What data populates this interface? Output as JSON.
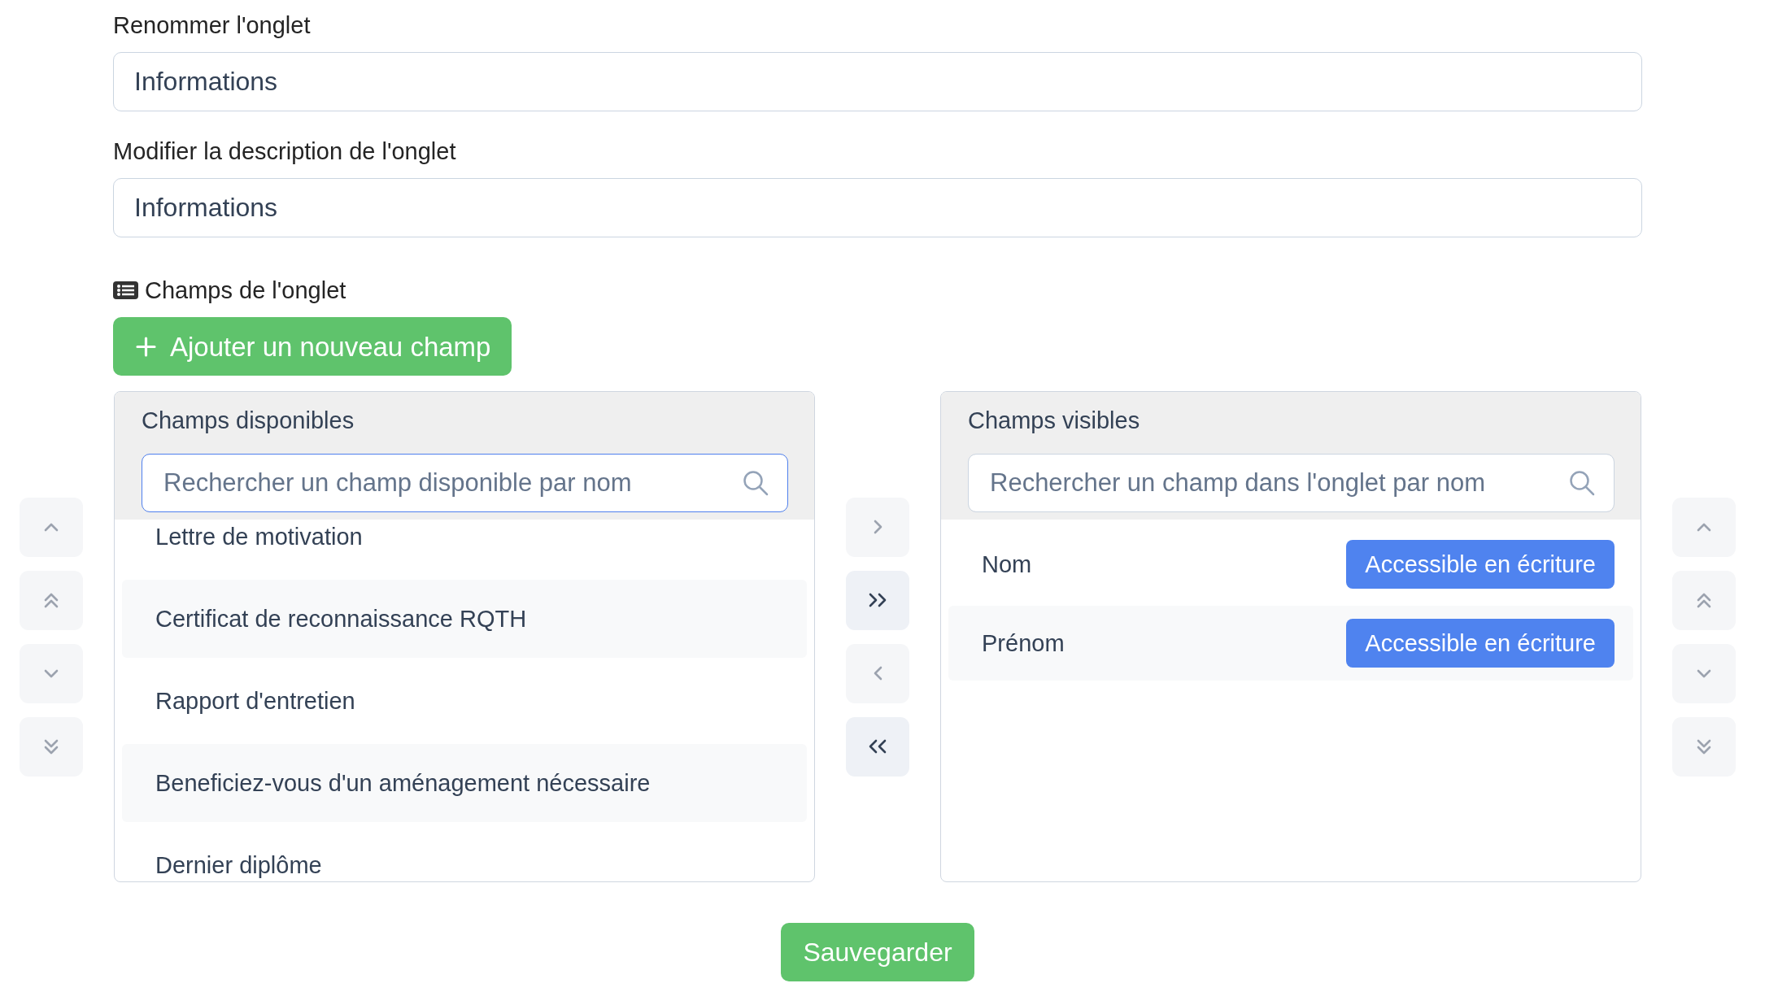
{
  "tab_name": {
    "label": "Renommer l'onglet",
    "value": "Informations"
  },
  "tab_description": {
    "label": "Modifier la description de l'onglet",
    "value": "Informations"
  },
  "fields_section": {
    "title": "Champs de l'onglet",
    "add_button": "Ajouter un nouveau champ"
  },
  "left_buttons": [
    {
      "kind": "up",
      "disabled": true
    },
    {
      "kind": "top",
      "disabled": true
    },
    {
      "kind": "down",
      "disabled": true
    },
    {
      "kind": "bottom",
      "disabled": true
    }
  ],
  "available_panel": {
    "title": "Champs disponibles",
    "search": {
      "placeholder": "Rechercher un champ disponible par nom",
      "focused": true
    },
    "items": [
      {
        "label": "Lettre de motivation",
        "selected": false
      },
      {
        "label": "Certificat de reconnaissance RQTH",
        "selected": false
      },
      {
        "label": "Rapport d'entretien",
        "selected": false
      },
      {
        "label": "Beneficiez-vous d'un aménagement nécessaire",
        "selected": false
      },
      {
        "label": "Dernier diplôme",
        "selected": false
      }
    ]
  },
  "transfer_buttons": [
    {
      "kind": "right",
      "disabled": true
    },
    {
      "kind": "all-right",
      "disabled": false
    },
    {
      "kind": "left",
      "disabled": true
    },
    {
      "kind": "all-left",
      "disabled": false
    }
  ],
  "visible_panel": {
    "title": "Champs visibles",
    "search": {
      "placeholder": "Rechercher un champ dans l'onglet par nom",
      "focused": false
    },
    "items": [
      {
        "label": "Nom",
        "access": "Accessible en écriture",
        "selected": false
      },
      {
        "label": "Prénom",
        "access": "Accessible en écriture",
        "selected": false
      }
    ]
  },
  "right_buttons": [
    {
      "kind": "up",
      "disabled": true
    },
    {
      "kind": "top",
      "disabled": true
    },
    {
      "kind": "down",
      "disabled": true
    },
    {
      "kind": "bottom",
      "disabled": true
    }
  ],
  "save_button": "Sauvegarder"
}
